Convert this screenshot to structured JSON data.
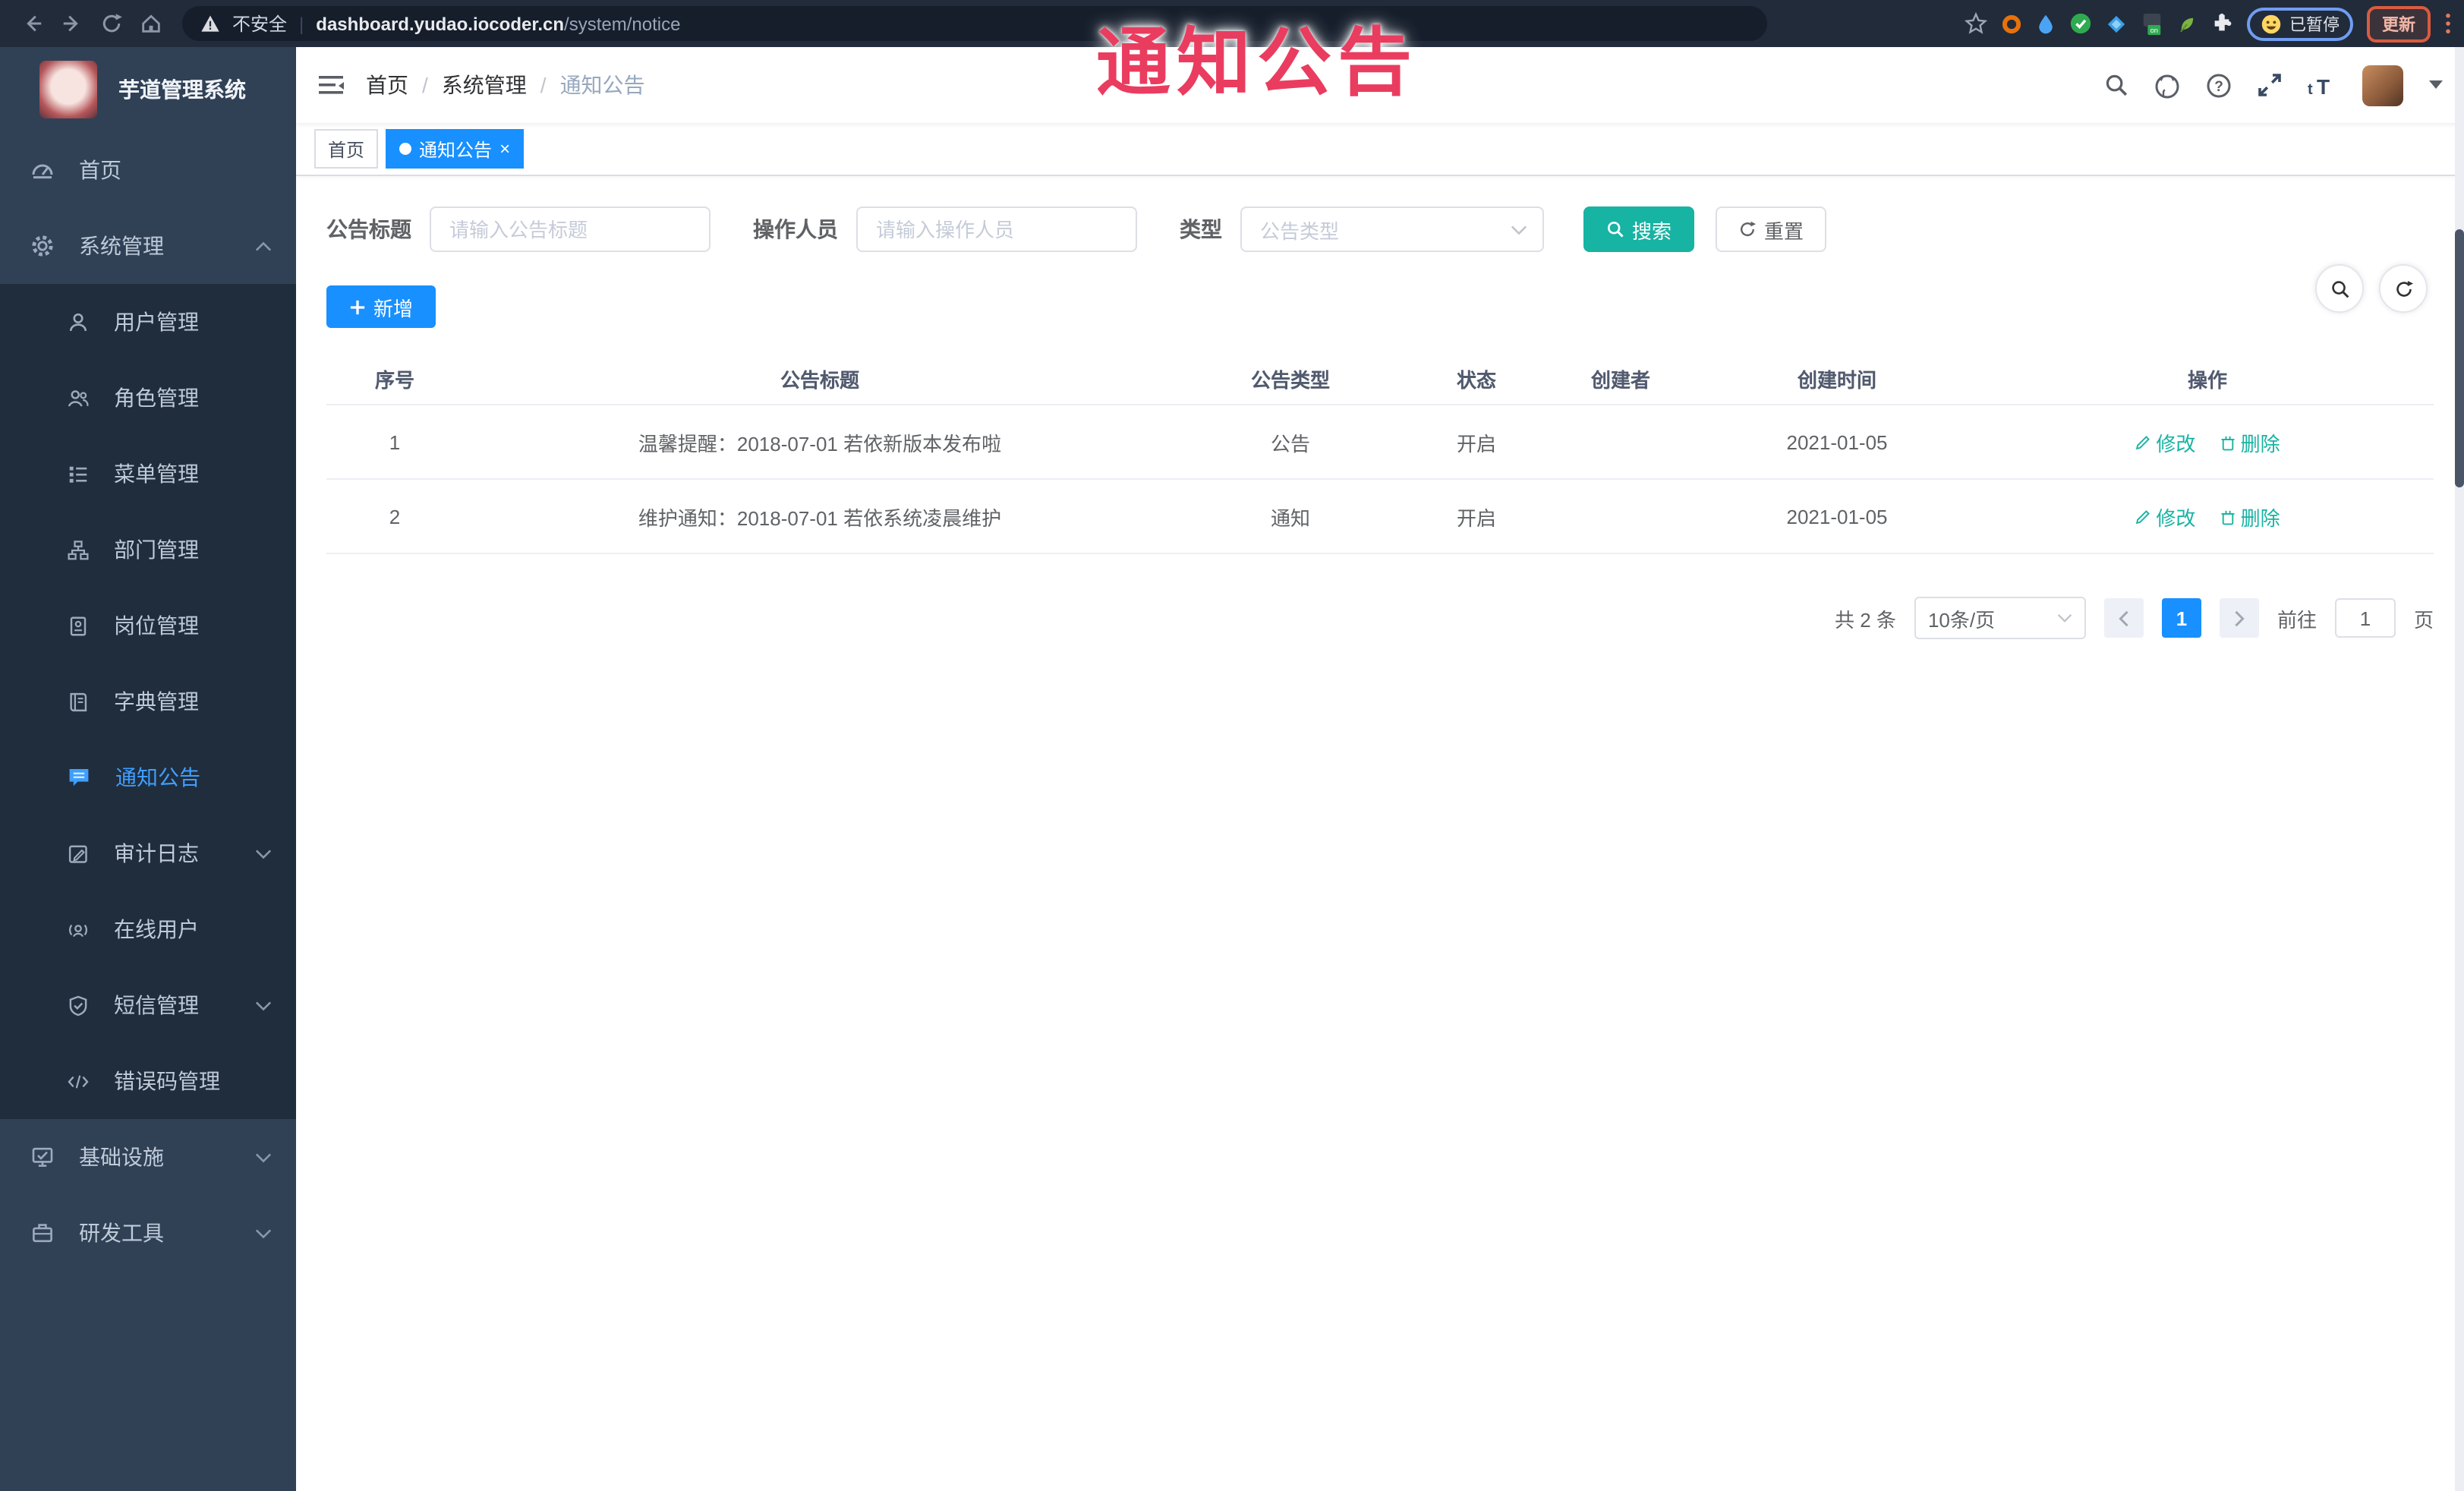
{
  "browser": {
    "security_label": "不安全",
    "url_host": "dashboard.yudao.iocoder.cn",
    "url_path": "/system/notice",
    "paused_badge": "已暂停",
    "update_button": "更新"
  },
  "watermark": "通知公告",
  "sidebar": {
    "app_title": "芋道管理系统",
    "items": [
      {
        "label": "首页",
        "icon": "dashboard-icon",
        "level": 1
      },
      {
        "label": "系统管理",
        "icon": "gear-icon",
        "level": 1,
        "chevron": "up"
      },
      {
        "label": "用户管理",
        "icon": "user-icon",
        "level": 2
      },
      {
        "label": "角色管理",
        "icon": "roles-icon",
        "level": 2
      },
      {
        "label": "菜单管理",
        "icon": "menu-tree-icon",
        "level": 2
      },
      {
        "label": "部门管理",
        "icon": "dept-icon",
        "level": 2
      },
      {
        "label": "岗位管理",
        "icon": "post-icon",
        "level": 2
      },
      {
        "label": "字典管理",
        "icon": "dict-icon",
        "level": 2
      },
      {
        "label": "通知公告",
        "icon": "notice-icon",
        "level": 2,
        "active": true
      },
      {
        "label": "审计日志",
        "icon": "audit-icon",
        "level": 2,
        "chevron": "down"
      },
      {
        "label": "在线用户",
        "icon": "online-users-icon",
        "level": 2
      },
      {
        "label": "短信管理",
        "icon": "sms-icon",
        "level": 2,
        "chevron": "down"
      },
      {
        "label": "错误码管理",
        "icon": "error-code-icon",
        "level": 2
      },
      {
        "label": "基础设施",
        "icon": "infra-icon",
        "level": 1,
        "chevron": "down"
      },
      {
        "label": "研发工具",
        "icon": "devtools-icon",
        "level": 1,
        "chevron": "down"
      }
    ]
  },
  "header": {
    "breadcrumb": [
      "首页",
      "系统管理",
      "通知公告"
    ]
  },
  "tabs": [
    {
      "label": "首页",
      "active": false
    },
    {
      "label": "通知公告",
      "active": true,
      "closable": true
    }
  ],
  "filters": {
    "title_label": "公告标题",
    "title_placeholder": "请输入公告标题",
    "operator_label": "操作人员",
    "operator_placeholder": "请输入操作人员",
    "type_label": "类型",
    "type_placeholder": "公告类型",
    "search_label": "搜索",
    "reset_label": "重置"
  },
  "toolbar": {
    "add_label": "新增"
  },
  "table": {
    "columns": [
      "序号",
      "公告标题",
      "公告类型",
      "状态",
      "创建者",
      "创建时间",
      "操作"
    ],
    "rows": [
      {
        "no": "1",
        "title": "温馨提醒：2018-07-01 若依新版本发布啦",
        "type": "公告",
        "status": "开启",
        "creator": "",
        "created": "2021-01-05"
      },
      {
        "no": "2",
        "title": "维护通知：2018-07-01 若依系统凌晨维护",
        "type": "通知",
        "status": "开启",
        "creator": "",
        "created": "2021-01-05"
      }
    ],
    "edit_label": "修改",
    "delete_label": "删除"
  },
  "pagination": {
    "total_text": "共 2 条",
    "page_size": "10条/页",
    "current_page": "1",
    "goto_label": "前往",
    "goto_value": "1",
    "page_unit": "页"
  },
  "colors": {
    "accent_blue": "#1890ff",
    "teal": "#17b3a3",
    "sidebar_bg": "#304156",
    "submenu_bg": "#1f2d3d",
    "active_menu": "#409eff",
    "watermark_red": "#ea3c5f"
  }
}
